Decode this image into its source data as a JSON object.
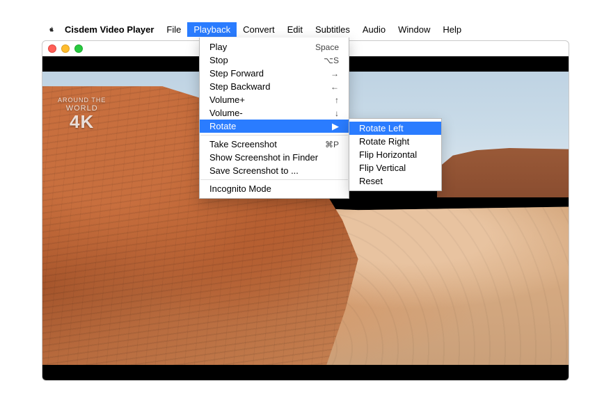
{
  "menubar": {
    "app_name": "Cisdem Video Player",
    "items": [
      "File",
      "Playback",
      "Convert",
      "Edit",
      "Subtitles",
      "Audio",
      "Window",
      "Help"
    ],
    "active_index": 1
  },
  "watermark": {
    "line1": "AROUND THE",
    "line2": "WORLD",
    "line3": "4K"
  },
  "playback_menu": {
    "items": [
      {
        "label": "Play",
        "shortcut": "Space"
      },
      {
        "label": "Stop",
        "shortcut": "⌥S"
      },
      {
        "label": "Step Forward",
        "shortcut": "→"
      },
      {
        "label": "Step Backward",
        "shortcut": "←"
      },
      {
        "label": "Volume+",
        "shortcut": "↑"
      },
      {
        "label": "Volume-",
        "shortcut": "↓"
      },
      {
        "label": "Rotate",
        "submenu": true,
        "highlighted": true
      },
      {
        "sep": true
      },
      {
        "label": "Take Screenshot",
        "shortcut": "⌘P"
      },
      {
        "label": "Show Screenshot in Finder"
      },
      {
        "label": "Save Screenshot to ..."
      },
      {
        "sep": true
      },
      {
        "label": "Incognito Mode"
      }
    ]
  },
  "rotate_submenu": {
    "items": [
      {
        "label": "Rotate Left",
        "highlighted": true
      },
      {
        "label": "Rotate Right"
      },
      {
        "label": "Flip Horizontal"
      },
      {
        "label": "Flip Vertical"
      },
      {
        "label": "Reset"
      }
    ]
  }
}
